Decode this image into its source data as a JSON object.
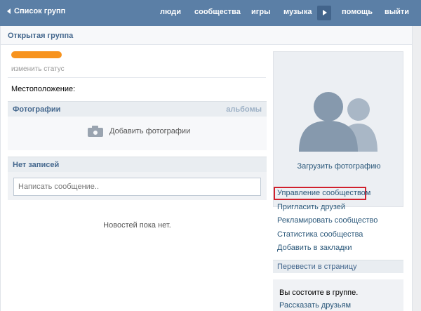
{
  "topbar": {
    "back_label": "Список групп",
    "nav": [
      "люди",
      "сообщества",
      "игры",
      "музыка",
      "помощь",
      "выйти"
    ]
  },
  "header": {
    "title": "Открытая группа"
  },
  "profile": {
    "change_status": "изменить статус",
    "location_label": "Местоположение:"
  },
  "photos": {
    "title": "Фотографии",
    "albums_link": "альбомы",
    "add_label": "Добавить фотографии"
  },
  "posts": {
    "title": "Нет записей",
    "placeholder": "Написать сообщение..",
    "empty_text": "Новостей пока нет."
  },
  "sidebar": {
    "upload_photo": "Загрузить фотографию",
    "links": [
      "Управление сообществом",
      "Пригласить друзей",
      "Рекламировать сообщество",
      "Статистика сообщества",
      "Добавить в закладки"
    ],
    "translate": "Перевести в страницу",
    "member_text": "Вы состоите в группе.",
    "tell_friends": "Рассказать друзьям"
  },
  "colors": {
    "topbar": "#5b7fa6",
    "link": "#2b587a",
    "highlight": "#d0202c",
    "redaction": "#f7931e"
  }
}
